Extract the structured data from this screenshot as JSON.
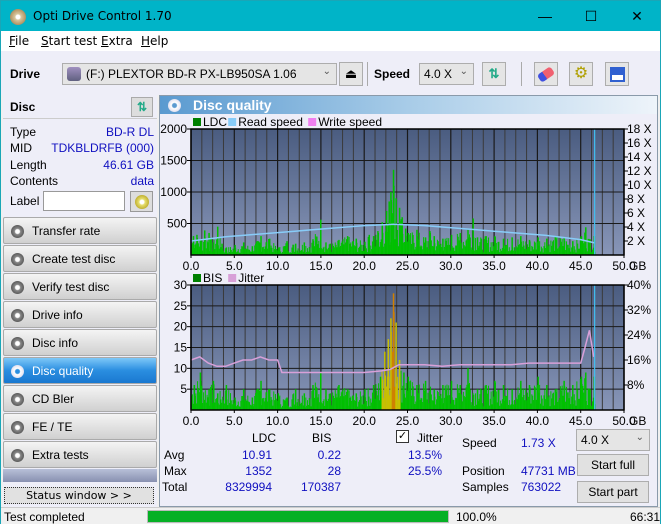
{
  "window": {
    "title": "Opti Drive Control 1.70",
    "minimize": "—",
    "maximize": "☐",
    "close": "✕"
  },
  "menu": [
    {
      "label": "File",
      "key": "F",
      "rest": "ile"
    },
    {
      "label": "Start test",
      "key": "S",
      "rest": "tart test"
    },
    {
      "label": "Extra",
      "key": "E",
      "pre": "",
      "rest": "xtra"
    },
    {
      "label": "Help",
      "key": "H",
      "rest": "elp"
    }
  ],
  "toolbar": {
    "drive_label": "Drive",
    "drive_value": "(F:)  PLEXTOR BD-R  PX-LB950SA 1.06",
    "speed_label": "Speed",
    "speed_value": "4.0 X",
    "icons": [
      "eject-icon",
      "refresh-icon",
      "erase-icon",
      "settings-icon",
      "save-icon"
    ]
  },
  "disc": {
    "title": "Disc",
    "rows": [
      {
        "key": "Type",
        "value": "BD-R DL"
      },
      {
        "key": "MID",
        "value": "TDKBLDRFB (000)"
      },
      {
        "key": "Length",
        "value": "46.61 GB"
      },
      {
        "key": "Contents",
        "value": "data"
      }
    ],
    "label_key": "Label",
    "label_value": ""
  },
  "nav": [
    {
      "label": "Transfer rate",
      "active": false
    },
    {
      "label": "Create test disc",
      "active": false
    },
    {
      "label": "Verify test disc",
      "active": false
    },
    {
      "label": "Drive info",
      "active": false
    },
    {
      "label": "Disc info",
      "active": false
    },
    {
      "label": "Disc quality",
      "active": true
    },
    {
      "label": "CD Bler",
      "active": false
    },
    {
      "label": "FE / TE",
      "active": false
    },
    {
      "label": "Extra tests",
      "active": false
    }
  ],
  "status_window_label": "Status window > >",
  "panel_title": "Disc quality",
  "chart_data": [
    {
      "type": "bar",
      "title": "LDC / Read speed",
      "legend": [
        {
          "name": "LDC",
          "color": "#008000"
        },
        {
          "name": "Read speed",
          "color": "#88ccf8"
        },
        {
          "name": "Write speed",
          "color": "#f080f0"
        }
      ],
      "legend_position": "top-left",
      "xlabel": "GB",
      "x_ticks": [
        "0.0",
        "5.0",
        "10.0",
        "15.0",
        "20.0",
        "25.0",
        "30.0",
        "35.0",
        "40.0",
        "45.0",
        "50.0"
      ],
      "xlim": [
        0,
        50
      ],
      "y_ticks": [
        "500",
        "1000",
        "1500",
        "2000"
      ],
      "ylim": [
        0,
        2000
      ],
      "y2_ticks": [
        "2 X",
        "4 X",
        "6 X",
        "8 X",
        "10 X",
        "12 X",
        "14 X",
        "16 X",
        "18 X"
      ],
      "y2lim": [
        0,
        18
      ],
      "grid": true,
      "end_marker_gb": 46.61,
      "series": [
        {
          "name": "LDC",
          "color": "#00c000",
          "x": [
            0.2,
            0.6,
            1.0,
            1.5,
            2.0,
            2.5,
            3.0,
            3.5,
            4.0,
            5.0,
            6.0,
            7.0,
            8.0,
            9.0,
            10.0,
            11.0,
            12.0,
            13.0,
            14.0,
            14.9,
            15.5,
            16.0,
            17.0,
            18.0,
            19.0,
            20.0,
            20.5,
            21.0,
            21.5,
            22.0,
            22.5,
            22.8,
            23.0,
            23.3,
            23.6,
            24.0,
            24.3,
            24.7,
            25.0,
            26.0,
            27.0,
            27.5,
            28.0,
            29.0,
            30.0,
            31.0,
            31.9,
            32.5,
            33.0,
            34.0,
            35.0,
            36.0,
            37.0,
            38.0,
            39.0,
            40.0,
            41.0,
            42.0,
            43.0,
            44.0,
            45.0,
            45.5,
            46.0,
            46.5
          ],
          "values": [
            300,
            320,
            250,
            390,
            350,
            200,
            450,
            180,
            120,
            160,
            200,
            140,
            300,
            260,
            120,
            220,
            180,
            200,
            250,
            560,
            200,
            180,
            240,
            300,
            260,
            210,
            320,
            300,
            380,
            520,
            700,
            850,
            1000,
            1352,
            900,
            750,
            600,
            420,
            350,
            400,
            280,
            380,
            300,
            260,
            320,
            350,
            400,
            580,
            280,
            300,
            300,
            260,
            280,
            300,
            240,
            280,
            260,
            300,
            280,
            220,
            300,
            440,
            250,
            300
          ]
        },
        {
          "name": "Read speed",
          "color": "#88ccf8",
          "x": [
            0,
            2,
            4,
            6,
            8,
            10,
            12,
            14,
            16,
            18,
            20,
            22,
            23.5,
            25,
            27,
            29,
            31,
            33,
            35,
            37,
            39,
            41,
            43,
            45,
            46.6
          ],
          "values": [
            2.0,
            2.3,
            2.6,
            2.8,
            3.0,
            3.2,
            3.4,
            3.6,
            3.8,
            4.0,
            4.2,
            4.3,
            4.4,
            4.3,
            4.2,
            4.0,
            3.8,
            3.6,
            3.4,
            3.2,
            3.0,
            2.8,
            2.5,
            2.2,
            1.73
          ]
        }
      ]
    },
    {
      "type": "bar",
      "title": "BIS / Jitter",
      "legend": [
        {
          "name": "BIS",
          "color": "#008000"
        },
        {
          "name": "Jitter",
          "color": "#d8a0d8"
        }
      ],
      "legend_position": "top-left",
      "xlabel": "GB",
      "x_ticks": [
        "0.0",
        "5.0",
        "10.0",
        "15.0",
        "20.0",
        "25.0",
        "30.0",
        "35.0",
        "40.0",
        "45.0",
        "50.0"
      ],
      "xlim": [
        0,
        50
      ],
      "y_ticks": [
        "5",
        "10",
        "15",
        "20",
        "25",
        "30"
      ],
      "ylim": [
        0,
        30
      ],
      "y2_ticks": [
        "8%",
        "16%",
        "24%",
        "32%",
        "40%"
      ],
      "y2lim": [
        0,
        40
      ],
      "grid": true,
      "end_marker_gb": 46.61,
      "series": [
        {
          "name": "BIS",
          "color": "#00c000",
          "x": [
            0.3,
            1.0,
            2.0,
            2.5,
            3.0,
            4.0,
            5.0,
            6.0,
            7.0,
            8.0,
            9.0,
            10.0,
            11.0,
            12.0,
            13.0,
            14.0,
            14.9,
            15.5,
            16.0,
            17.0,
            18.0,
            19.0,
            20.0,
            21.0,
            21.8,
            22.3,
            22.7,
            23.0,
            23.3,
            23.6,
            24.0,
            24.5,
            25.0,
            26.0,
            27.0,
            28.0,
            29.0,
            30.0,
            31.0,
            31.9,
            33.0,
            34.0,
            35.0,
            36.0,
            37.0,
            38.0,
            39.0,
            40.0,
            41.0,
            42.0,
            43.0,
            44.0,
            45.0,
            45.5,
            46.0,
            46.5
          ],
          "values": [
            6,
            9,
            5,
            7,
            4,
            6,
            3,
            5,
            3,
            7,
            5,
            4,
            3,
            5,
            4,
            6,
            9,
            5,
            4,
            6,
            5,
            4,
            5,
            6,
            8,
            14,
            17,
            22,
            28,
            21,
            12,
            9,
            8,
            6,
            7,
            5,
            6,
            7,
            6,
            10,
            5,
            6,
            7,
            6,
            5,
            7,
            6,
            8,
            6,
            5,
            7,
            6,
            8,
            9,
            5,
            8
          ]
        },
        {
          "name": "Jitter",
          "color": "#d8a0d8",
          "x": [
            0,
            1,
            2,
            3,
            4,
            5,
            6,
            7,
            8,
            9,
            10,
            10.5,
            12,
            14,
            16,
            18,
            20,
            22,
            23,
            24,
            25,
            27,
            29,
            31,
            33,
            35,
            37,
            39,
            41,
            43,
            45,
            45.5,
            46,
            46.5
          ],
          "values": [
            16,
            17,
            15,
            14,
            14,
            15,
            16,
            16,
            17,
            16,
            16,
            12,
            12,
            12,
            12,
            12,
            12,
            12.5,
            13,
            14.5,
            14.5,
            14.5,
            14,
            14.5,
            14.5,
            14.5,
            14.5,
            15,
            15,
            15,
            15,
            20,
            25.5,
            17
          ]
        }
      ]
    }
  ],
  "stats": {
    "headers": [
      "",
      "LDC",
      "BIS"
    ],
    "rows": [
      {
        "label": "Avg",
        "ldc": "10.91",
        "bis": "0.22",
        "jitter": "13.5%"
      },
      {
        "label": "Max",
        "ldc": "1352",
        "bis": "28",
        "jitter": "25.5%"
      },
      {
        "label": "Total",
        "ldc": "8329994",
        "bis": "170387",
        "jitter": ""
      }
    ],
    "jitter_label": "Jitter",
    "jitter_checked": true,
    "speed_label": "Speed",
    "speed_value": "1.73 X",
    "position_label": "Position",
    "position_value": "47731 MB",
    "samples_label": "Samples",
    "samples_value": "763022",
    "speed_select": "4.0 X",
    "start_full": "Start full",
    "start_part": "Start part"
  },
  "statusbar": {
    "text": "Test completed",
    "progress_percent": 100.0,
    "percent_text": "100.0%",
    "elapsed": "66:31"
  }
}
